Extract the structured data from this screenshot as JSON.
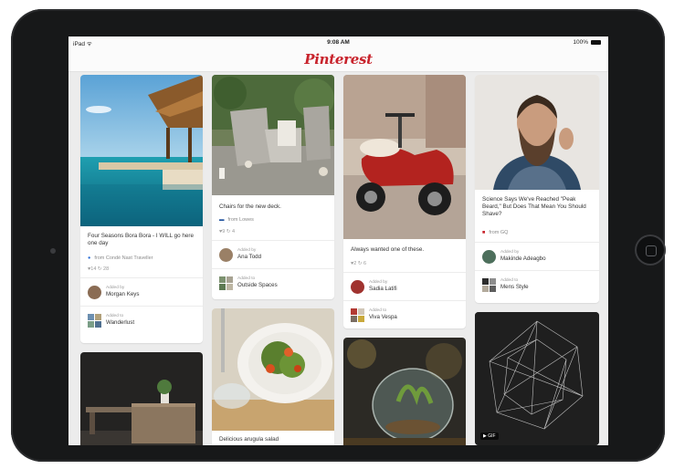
{
  "status": {
    "carrier": "iPad",
    "time": "9:08 AM",
    "battery": "100%"
  },
  "logo": "Pinterest",
  "pins": [
    {
      "desc": "Four Seasons Bora Bora - I WILL go here one day",
      "source": "from Condé Nast Traveller",
      "stats": "♥14 ↻ 28",
      "rows": [
        {
          "small": "Added by",
          "name": "Morgan Keys"
        },
        {
          "small": "Added to",
          "name": "Wanderlust"
        }
      ]
    },
    {
      "desc": "Chairs for the new deck.",
      "source": "from Lowes",
      "stats": "♥9 ↻ 4",
      "rows": [
        {
          "small": "Added by",
          "name": "Ana Todd"
        },
        {
          "small": "Added to",
          "name": "Outside Spaces"
        }
      ]
    },
    {
      "desc": "Always wanted one of these.",
      "stats": "♥2 ↻ 6",
      "rows": [
        {
          "small": "Added by",
          "name": "Sadia Latifi"
        },
        {
          "small": "Added to",
          "name": "Viva Vespa"
        }
      ]
    },
    {
      "desc": "Science Says We've Reached \"Peak Beard,\" But Does That Mean You Should Shave?",
      "source": "from GQ",
      "rows": [
        {
          "small": "Added by",
          "name": "Makinde Adeagbo"
        },
        {
          "small": "Added to",
          "name": "Mens Style"
        }
      ]
    },
    {
      "desc": "Delicious arugula salad"
    },
    {
      "badge": "▶ GIF"
    }
  ]
}
